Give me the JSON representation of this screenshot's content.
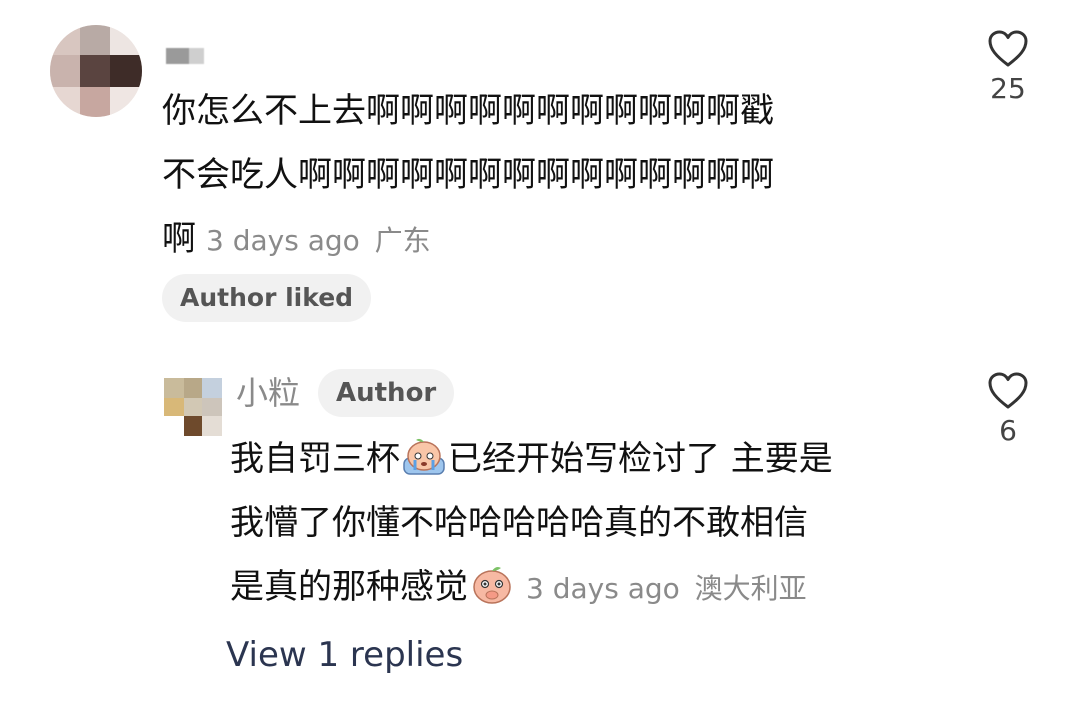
{
  "comment": {
    "username": "",
    "text_line1": "你怎么不上去啊啊啊啊啊啊啊啊啊啊啊戳",
    "text_line2": "不会吃人啊啊啊啊啊啊啊啊啊啊啊啊啊啊",
    "text_line3": "啊",
    "time": "3 days ago",
    "location": "广东",
    "author_liked_label": "Author liked",
    "like_count": "25"
  },
  "reply": {
    "username": "小粒",
    "author_badge": "Author",
    "text_line1_part1": "我自罚三杯",
    "text_line1_part2": "已经开始写检讨了 主要是",
    "text_line2": "我懵了你懂不哈哈哈哈哈真的不敢相信",
    "text_line3": "是真的那种感觉",
    "time": "3 days ago",
    "location": "澳大利亚",
    "like_count": "6",
    "emoji_1": "crying-peach-icon",
    "emoji_2": "shy-peach-icon"
  },
  "view_replies_label": "View 1 replies"
}
